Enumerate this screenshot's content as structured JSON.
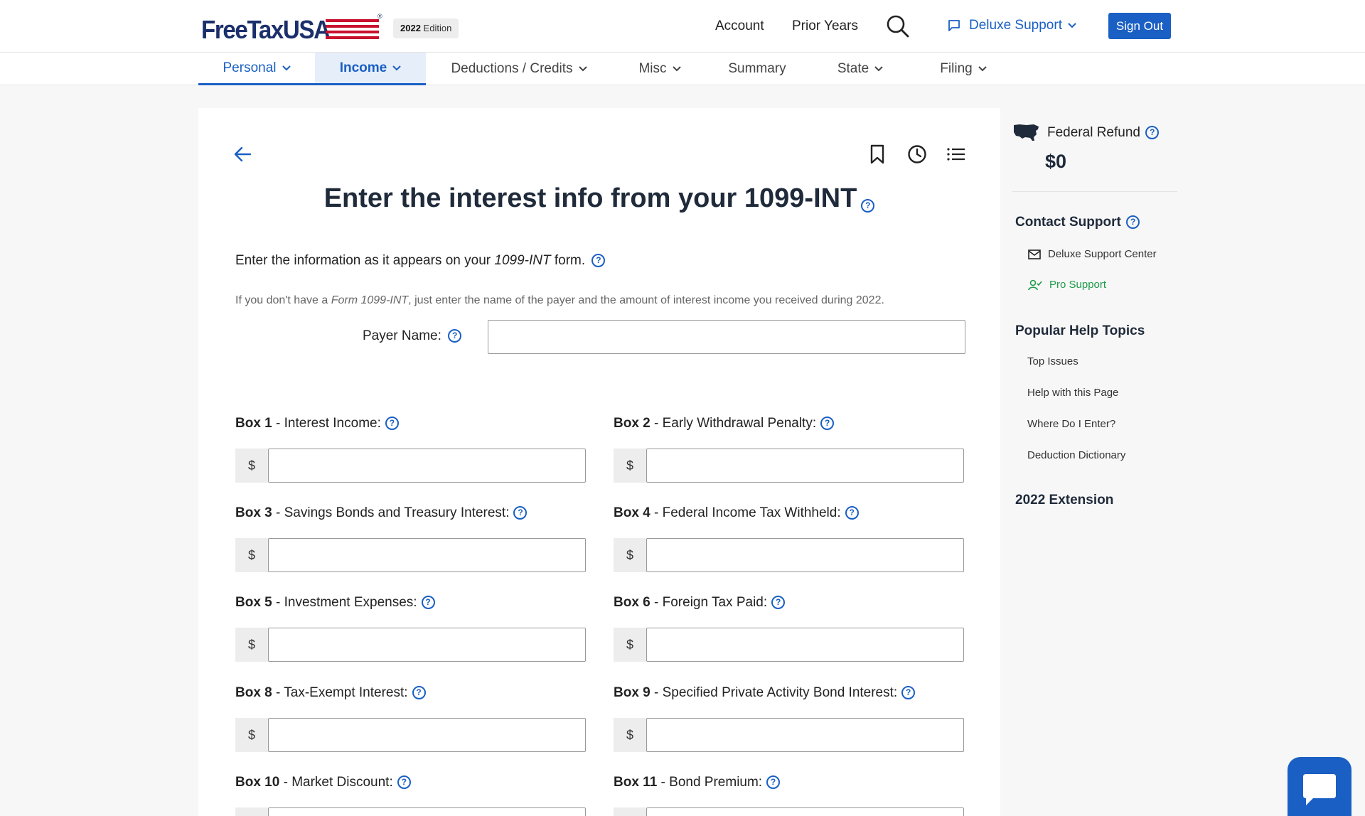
{
  "header": {
    "logo_text": "FreeTaxUSA",
    "logo_reg": "®",
    "edition_year": "2022",
    "edition_label": "Edition",
    "account": "Account",
    "prior_years": "Prior Years",
    "support": "Deluxe Support",
    "sign_out": "Sign Out"
  },
  "nav": {
    "tabs": [
      {
        "label": "Personal"
      },
      {
        "label": "Income"
      },
      {
        "label": "Deductions / Credits"
      },
      {
        "label": "Misc"
      },
      {
        "label": "Summary"
      },
      {
        "label": "State"
      },
      {
        "label": "Filing"
      }
    ]
  },
  "main": {
    "title": "Enter the interest info from your 1099-INT",
    "intro_before": "Enter the information as it appears on your ",
    "intro_italic": "1099-INT",
    "intro_after": " form.",
    "note_before": "If you don't have a ",
    "note_italic": "Form 1099-INT",
    "note_after": ", just enter the name of the payer and the amount of interest income you received during 2022.",
    "payer_label": "Payer Name:",
    "payer_value": "",
    "currency_symbol": "$",
    "boxes": [
      {
        "num": "Box 1",
        "label": " - Interest Income:",
        "value": ""
      },
      {
        "num": "Box 2",
        "label": " - Early Withdrawal Penalty:",
        "value": ""
      },
      {
        "num": "Box 3",
        "label": " - Savings Bonds and Treasury Interest:",
        "value": ""
      },
      {
        "num": "Box 4",
        "label": " - Federal Income Tax Withheld:",
        "value": ""
      },
      {
        "num": "Box 5",
        "label": " - Investment Expenses:",
        "value": ""
      },
      {
        "num": "Box 6",
        "label": " - Foreign Tax Paid:",
        "value": ""
      },
      {
        "num": "Box 8",
        "label": " - Tax-Exempt Interest:",
        "value": ""
      },
      {
        "num": "Box 9",
        "label": " - Specified Private Activity Bond Interest:",
        "value": ""
      },
      {
        "num": "Box 10",
        "label": " - Market Discount:",
        "value": ""
      },
      {
        "num": "Box 11",
        "label": " - Bond Premium:",
        "value": ""
      }
    ]
  },
  "sidebar": {
    "refund_label": "Federal Refund",
    "refund_value": "$0",
    "contact_heading": "Contact Support",
    "contact_links": [
      "Deluxe Support Center",
      "Pro Support"
    ],
    "help_heading": "Popular Help Topics",
    "help_links": [
      "Top Issues",
      "Help with this Page",
      "Where Do I Enter?",
      "Deduction Dictionary"
    ],
    "extension_heading": "2022 Extension"
  },
  "colors": {
    "accent": "#1a5fc4",
    "brand_navy": "#1b2f6b",
    "brand_red": "#c8102e",
    "pro_support_green": "#1e9a4a"
  },
  "icons": {
    "search": "search-icon",
    "chat": "speech-bubble-icon",
    "bookmark": "bookmark-icon",
    "history": "clock-icon",
    "list": "list-icon",
    "back": "arrow-left-icon",
    "map": "usa-map-icon",
    "mail": "mail-icon",
    "pro": "user-check-icon"
  }
}
